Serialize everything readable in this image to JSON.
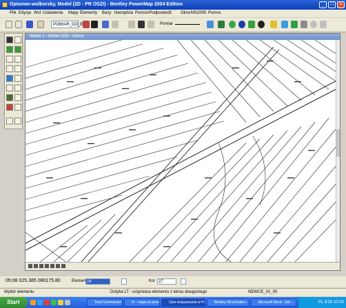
{
  "titlebar": {
    "title": "Opisowo-wolborzky, Model (2D - PR OSZI) - Bentley PowerMap 2004 Edition"
  },
  "menu": [
    "Plik",
    "Edycja",
    "Wst",
    "Ustawienia",
    "Mapy",
    "Elementy",
    "Bazy",
    "Narzędzia",
    "Pomoc/Podpowiedź",
    "Okno",
    "MS2005",
    "Pomoc"
  ],
  "toolbar": {
    "level_value": "POMIAR_DO_ELS",
    "line_style_label": "Pomiar"
  },
  "view": {
    "title": "Widok 1 - Model (2D) - Górny"
  },
  "status": {
    "coord_text": "05:08 025.385 080175.80",
    "element_label": "Element",
    "element_value": "24",
    "color_label": "Kol",
    "color_value": "27"
  },
  "statusbar": {
    "left": "Wybór elementu",
    "middle": "Dotyka LT - ustyniowa elementu z ekrou dwugisnego",
    "right": "NEWCE_01_00"
  },
  "taskbar": {
    "start_label": "Start",
    "tasks": [
      "Total Commander 7...",
      "Fr - mapa zs proce...",
      "Opis wstępowania w Polsce 2004",
      "Bentley MicroStation - widok...",
      "Microsoft Word - dok..."
    ],
    "tray_text": "PL 9:20 10:00"
  },
  "colors": {
    "titlebar": "#0a3fb8",
    "taskbar": "#245edb",
    "start": "#2f8a2f",
    "map_line": "#222222"
  }
}
